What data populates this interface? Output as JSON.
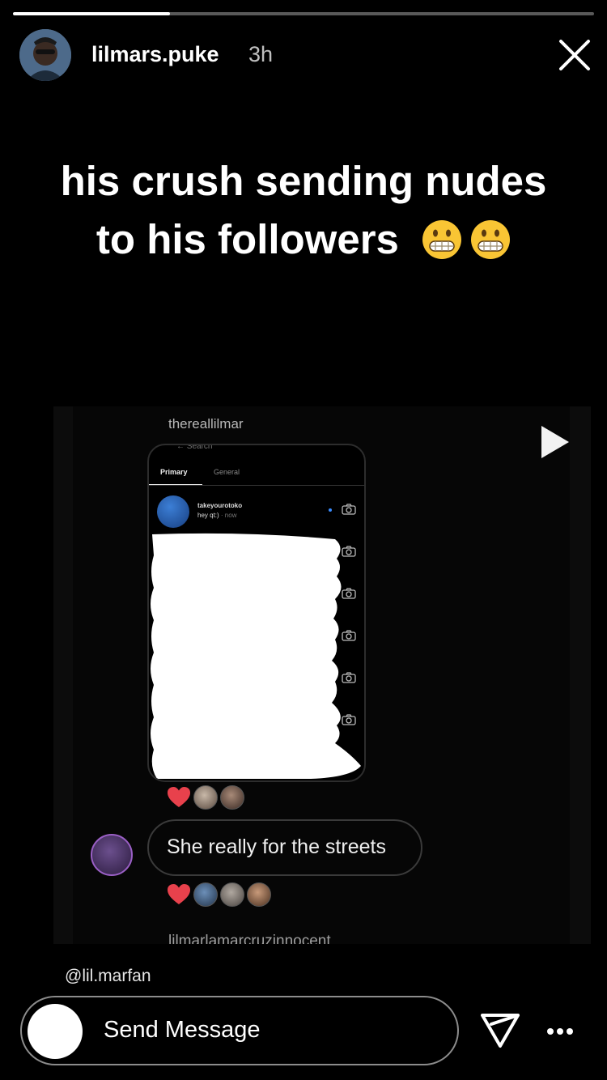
{
  "story": {
    "progress": 0.27,
    "username": "lilmars.puke",
    "time": "3h",
    "close_icon": "close-icon"
  },
  "caption": {
    "line1": "his crush sending nudes",
    "line2": "to his followers",
    "emojis": [
      "grimacing-emoji",
      "grimacing-emoji"
    ]
  },
  "post": {
    "handle": "thereallilmar",
    "play_icon": "play-icon",
    "phone": {
      "search": "← Search",
      "tab_primary": "Primary",
      "tab_general": "General",
      "dm_name": "takeyourotoko",
      "dm_message": "hey qt:)",
      "dm_time": "· now"
    },
    "comment": "She really for the streets",
    "footer_handle": "lilmarlamarcruzinnocent"
  },
  "mention": "@lil.marfan",
  "footer": {
    "placeholder": "Send Message",
    "send_icon": "send-icon",
    "more_icon": "more-icon"
  },
  "colors": {
    "background": "#000000",
    "heart": "#e8414c",
    "unread_dot": "#3a8cff"
  }
}
